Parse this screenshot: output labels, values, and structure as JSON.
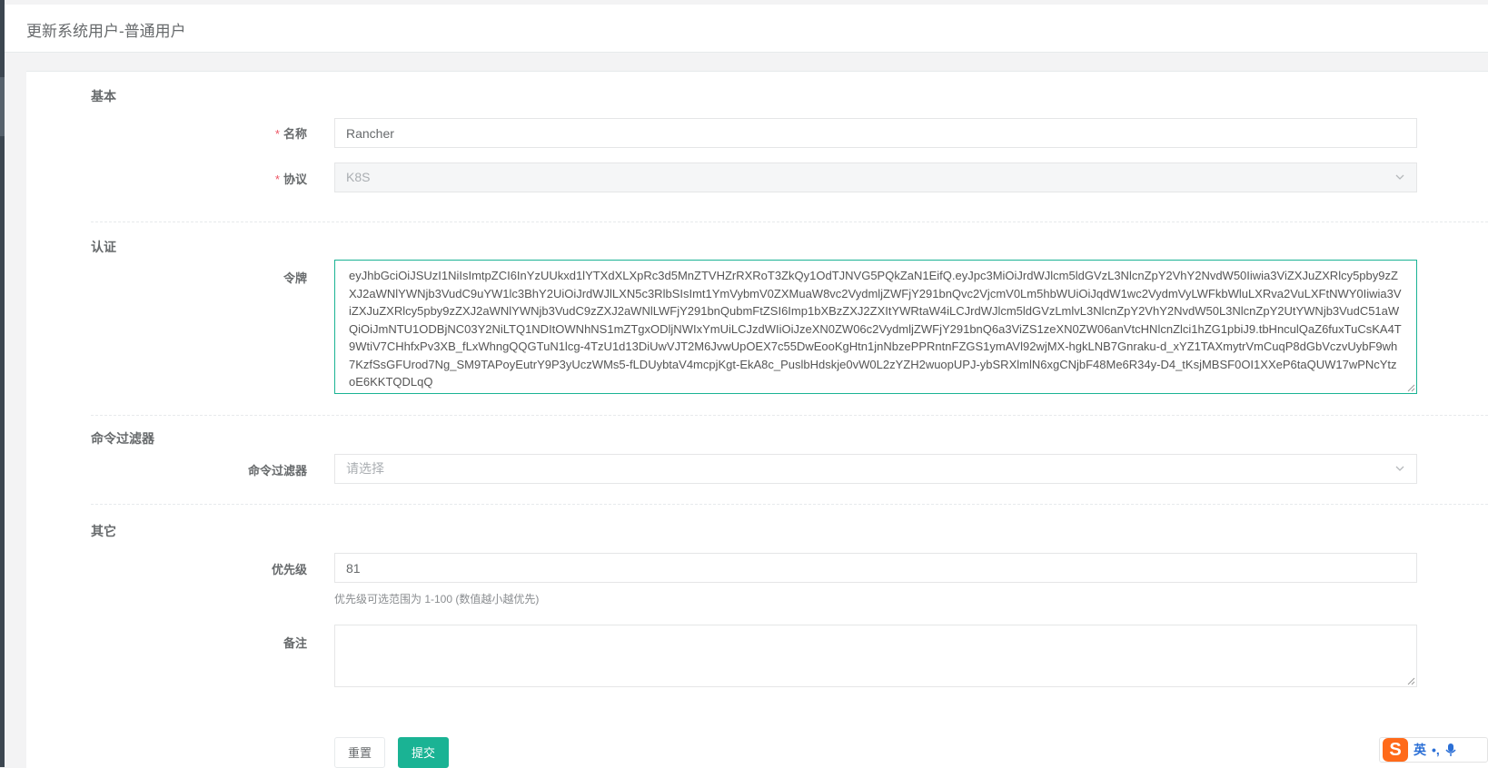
{
  "header": {
    "title": "更新系统用户-普通用户"
  },
  "sections": {
    "basic": "基本",
    "auth": "认证",
    "cmd_filter": "命令过滤器",
    "other": "其它"
  },
  "form": {
    "name": {
      "label": "名称",
      "required": "*",
      "value": "Rancher"
    },
    "protocol": {
      "label": "协议",
      "required": "*",
      "value": "K8S"
    },
    "token": {
      "label": "令牌",
      "value": "eyJhbGciOiJSUzI1NiIsImtpZCI6InYzUUkxd1lYTXdXLXpRc3d5MnZTVHZrRXRoT3ZkQy1OdTJNVG5PQkZaN1EifQ.eyJpc3MiOiJrdWJlcm5ldGVzL3NlcnZpY2VhY2NvdW50Iiwia3ViZXJuZXRlcy5pby9zZXJ2aWNlYWNjb3VudC9uYW1lc3BhY2UiOiJrdWJlLXN5c3RlbSIsImt1YmVybmV0ZXMuaW8vc2VydmljZWFjY291bnQvc2VjcmV0Lm5hbWUiOiJqdW1wc2VydmVyLWFkbWluLXRva2VuLXFtNWY0Iiwia3ViZXJuZXRlcy5pby9zZXJ2aWNlYWNjb3VudC9zZXJ2aWNlLWFjY291bnQubmFtZSI6Imp1bXBzZXJ2ZXItYWRtaW4iLCJrdWJlcm5ldGVzLmlvL3NlcnZpY2VhY2NvdW50L3NlcnZpY2UtYWNjb3VudC51aWQiOiJmNTU1ODBjNC03Y2NiLTQ1NDItOWNhNS1mZTgxODljNWIxYmUiLCJzdWIiOiJzeXN0ZW06c2VydmljZWFjY291bnQ6a3ViZS1zeXN0ZW06anVtcHNlcnZlci1hZG1pbiJ9.tbHnculQaZ6fuxTuCsKA4T9WtiV7CHhfxPv3XB_fLxWhngQQGTuN1lcg-4TzU1d13DiUwVJT2M6JvwUpOEX7c55DwEooKgHtn1jnNbzePPRntnFZGS1ymAVl92wjMX-hgkLNB7Gnraku-d_xYZ1TAXmytrVmCuqP8dGbVczvUybF9wh7KzfSsGFUrod7Ng_SM9TAPoyEutrY9P3yUczWMs5-fLDUybtaV4mcpjKgt-EkA8c_PuslbHdskje0vW0L2zYZH2wuopUPJ-ybSRXlmlN6xgCNjbF48Me6R34y-D4_tKsjMBSF0OI1XXeP6taQUW17wPNcYtzoE6KKTQDLqQ"
    },
    "command_filter": {
      "label": "命令过滤器",
      "placeholder": "请选择"
    },
    "priority": {
      "label": "优先级",
      "value": "81",
      "help": "优先级可选范围为 1-100 (数值越小越优先)"
    },
    "comment": {
      "label": "备注",
      "value": ""
    }
  },
  "buttons": {
    "reset": "重置",
    "submit": "提交"
  },
  "ime": {
    "logo": "S",
    "lang": "英",
    "punct": "•,"
  },
  "colors": {
    "primary": "#1ab394",
    "required": "#ed5565",
    "text": "#676a6c"
  }
}
